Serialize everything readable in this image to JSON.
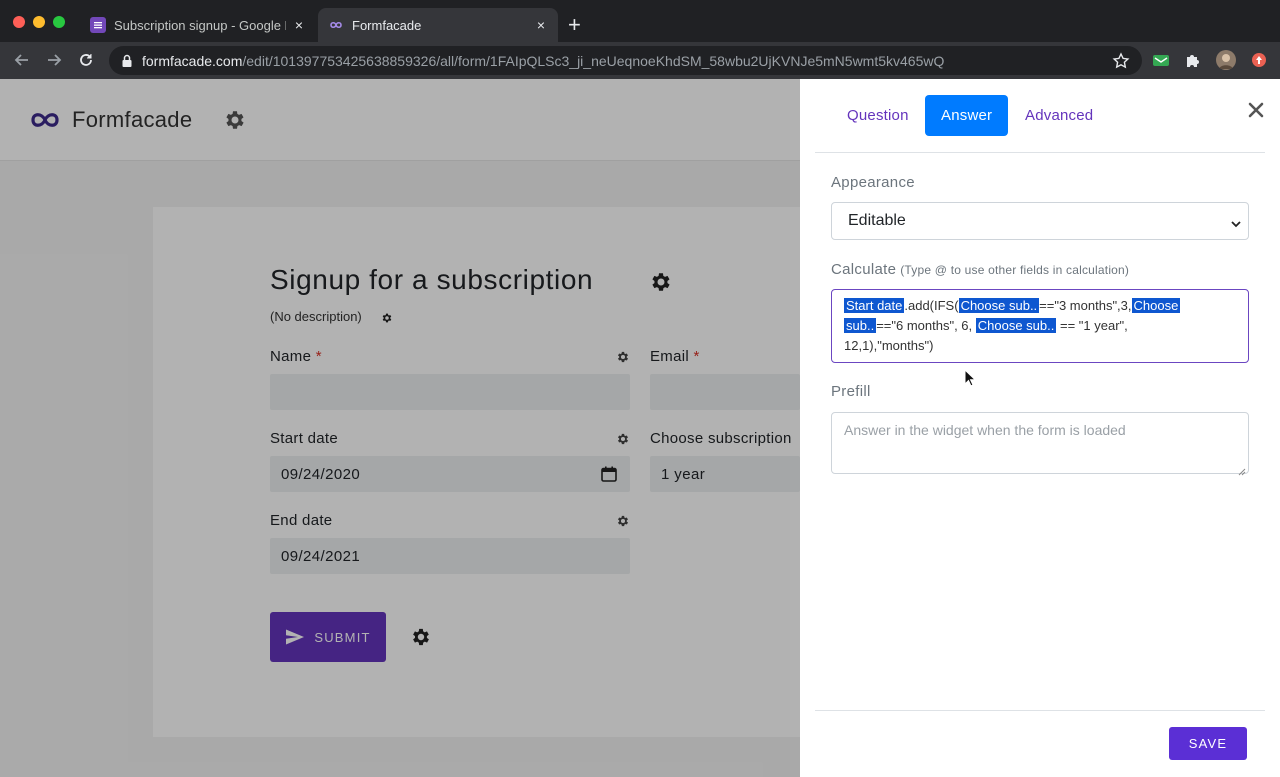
{
  "browser": {
    "tabs": [
      {
        "title": "Subscription signup - Google F",
        "favicon": "google-forms-icon",
        "active": false
      },
      {
        "title": "Formfacade",
        "favicon": "formfacade-icon",
        "active": true
      }
    ],
    "new_tab_label": "+",
    "url": {
      "host": "formfacade.com",
      "path": "/edit/101397753425638859326/all/form/1FAIpQLSc3_ji_neUeqnoeKhdSM_58wbu2UjKVNJe5mN5wmt5kv465wQ"
    }
  },
  "app": {
    "brand": "Formfacade"
  },
  "form": {
    "title": "Signup for a subscription",
    "description": "(No description)",
    "fields": {
      "name": {
        "label": "Name",
        "required_mark": "*",
        "value": ""
      },
      "email": {
        "label": "Email",
        "required_mark": "*",
        "value": ""
      },
      "start_date": {
        "label": "Start date",
        "value": "09/24/2020"
      },
      "subscription": {
        "label": "Choose subscription",
        "value": "1 year"
      },
      "end_date": {
        "label": "End date",
        "value": "09/24/2021"
      }
    },
    "submit_label": "SUBMIT",
    "submit_color": "#6434bc"
  },
  "panel": {
    "tabs": {
      "question": "Question",
      "answer": "Answer",
      "advanced": "Advanced"
    },
    "active_tab": "Answer",
    "appearance": {
      "label": "Appearance",
      "value": "Editable"
    },
    "calculate": {
      "label": "Calculate",
      "hint": "(Type @ to use other fields in calculation)",
      "tokens": {
        "start_date": "Start date",
        "t1": ".add(IFS(",
        "choose1": "Choose sub..",
        "t2": "==\"3 months\",3,",
        "choose2a": "Choose",
        "choose2b": "sub..",
        "t3": "==\"6 months\", 6, ",
        "choose3": "Choose sub..",
        "t4": " == \"1 year\",",
        "t5": "12,1),\"months\")"
      }
    },
    "prefill": {
      "label": "Prefill",
      "placeholder": "Answer in the widget when the form is loaded"
    },
    "save_label": "SAVE",
    "accent_color": "#5b2fd5",
    "active_tab_color": "#007bff"
  }
}
